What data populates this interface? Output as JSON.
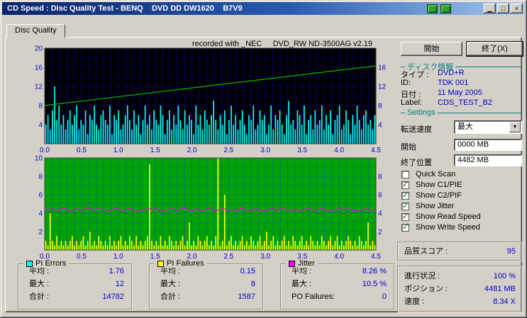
{
  "window": {
    "title": "CD Speed : Disc Quality Test - BENQ    DVD DD DW1620    B7V9"
  },
  "tabs": {
    "disc_quality": "Disc Quality"
  },
  "chart_header": "recorded with _NEC     DVD_RW ND-3500AG v2.19",
  "sidebar": {
    "start_button": "開始",
    "exit_button": "終了(X)",
    "disc_info": {
      "header": "ディスク情報",
      "rows": [
        [
          "タイプ :",
          "DVD+R"
        ],
        [
          "ID:",
          "TDK 001"
        ],
        [
          "日付 :",
          "11 May 2005"
        ],
        [
          "Label:",
          "CDS_TEST_B2"
        ]
      ]
    },
    "settings": {
      "header": "Settings",
      "speed_label": "転送速度",
      "speed_value": "最大",
      "start_label": "開始",
      "start_value": "0000 MB",
      "end_label": "終了位置",
      "end_value": "4482 MB",
      "checkboxes": [
        {
          "label": "Quick Scan",
          "checked": false
        },
        {
          "label": "Show C1/PIE",
          "checked": true
        },
        {
          "label": "Show C2/PIF",
          "checked": true
        },
        {
          "label": "Show Jitter",
          "checked": true
        },
        {
          "label": "Show Read Speed",
          "checked": true
        },
        {
          "label": "Show Write Speed",
          "checked": true
        }
      ]
    },
    "quality": {
      "label": "品質スコア :",
      "value": "95"
    },
    "status": {
      "rows": [
        [
          "進行状況 :",
          "100 %"
        ],
        [
          "ポジション :",
          "4481 MB"
        ],
        [
          "速度 :",
          "8.34 X"
        ]
      ]
    }
  },
  "stats_boxes": [
    {
      "title": "PI Errors",
      "color": "#00FFFF",
      "rows": [
        [
          "平均 :",
          "1.76"
        ],
        [
          "最大 :",
          "12"
        ],
        [
          "合計 :",
          "14782"
        ]
      ]
    },
    {
      "title": "PI Failures",
      "color": "#FFFF00",
      "rows": [
        [
          "平均 :",
          "0.15"
        ],
        [
          "最大 :",
          "8"
        ],
        [
          "合計 :",
          "1587"
        ]
      ]
    },
    {
      "title": "Jitter",
      "color": "#FF00FF",
      "rows": [
        [
          "平均 :",
          "8.26 %"
        ],
        [
          "最大 :",
          "10.5 %"
        ],
        [
          "PO Failures:",
          "0"
        ]
      ]
    }
  ],
  "chart_data": [
    {
      "type": "bar",
      "title": "PI Errors vs disc position (GB) with write speed line",
      "x_range": [
        0,
        4.5
      ],
      "y_range": [
        0,
        20
      ],
      "grid_x": 0.1,
      "grid_y": 2,
      "x_ticks": [
        "0.0",
        "0.5",
        "1.0",
        "1.5",
        "2.0",
        "2.5",
        "3.0",
        "3.5",
        "4.0",
        "4.5"
      ],
      "y_ticks_left": [
        20,
        16,
        12,
        8,
        4
      ],
      "y_ticks_right": [
        16,
        12,
        8,
        4
      ],
      "bg": "#000000",
      "grid_color": "#0000A8",
      "tick_color": "#0000C8",
      "bar_color": "#00FFFF",
      "bars": [
        4,
        6,
        3,
        7,
        12,
        5,
        8,
        4,
        6,
        3,
        5,
        7,
        4,
        6,
        8,
        3,
        5,
        4,
        7,
        2,
        6,
        5,
        8,
        4,
        3,
        6,
        7,
        5,
        4,
        8,
        2,
        6,
        5,
        7,
        3,
        4,
        6,
        8,
        5,
        3,
        7,
        4,
        6,
        2,
        5,
        8,
        4,
        6,
        3,
        7,
        5,
        4,
        8,
        6,
        2,
        5,
        7,
        3,
        6,
        4,
        8,
        5,
        3,
        7,
        4,
        6,
        5,
        2,
        8,
        4,
        6,
        3,
        7,
        5,
        4,
        6,
        9,
        5,
        3,
        6,
        4,
        7,
        2,
        5,
        8,
        4,
        6,
        3,
        5,
        7,
        4,
        2,
        6,
        5,
        8,
        3,
        4,
        7,
        5,
        6,
        2,
        4,
        8,
        3,
        6,
        5,
        7,
        4,
        2,
        6,
        9,
        4,
        5,
        3,
        7,
        6,
        4,
        8,
        2,
        5,
        6,
        3,
        7,
        4,
        5,
        8,
        3,
        6,
        4,
        7,
        2,
        5,
        6,
        8,
        3,
        4,
        7,
        5,
        2,
        6,
        4,
        8,
        5,
        3,
        6,
        7,
        4,
        5,
        3,
        6
      ],
      "lines": [
        {
          "name": "write-speed",
          "color": "#00C000",
          "points": [
            [
              0,
              8
            ],
            [
              4.5,
              16.3
            ]
          ]
        }
      ]
    },
    {
      "type": "bar",
      "title": "PI Failures vs disc position (GB) with jitter line",
      "x_range": [
        0,
        4.5
      ],
      "y_range": [
        0,
        10
      ],
      "grid_x": 0.1,
      "grid_y": 1,
      "x_ticks": [
        "0.0",
        "0.5",
        "1.0",
        "1.5",
        "2.0",
        "2.5",
        "3.0",
        "3.5",
        "4.0",
        "4.5"
      ],
      "y_ticks_left": [
        10,
        8,
        6,
        4,
        2
      ],
      "y_ticks_right": [
        8,
        6,
        4,
        2
      ],
      "bg": "#00A400",
      "grid_color": "#0058A8",
      "tick_color": "#0000C8",
      "bar_color": "#FFFF00",
      "bars": [
        1,
        0.5,
        4,
        1,
        0.5,
        1.5,
        0.5,
        1,
        0.5,
        1,
        0.5,
        1,
        1.5,
        0.5,
        1,
        0.5,
        1,
        1.5,
        0.5,
        1,
        2,
        0.5,
        1,
        0.5,
        1.5,
        1,
        0.5,
        1,
        0.5,
        1.5,
        0.5,
        1,
        0.5,
        1,
        1.5,
        0.5,
        1,
        0.5,
        1.5,
        1,
        0.5,
        1.5,
        0.5,
        1,
        0.5,
        1,
        1.5,
        9.3,
        1,
        0.5,
        1,
        0.5,
        1.5,
        0.5,
        1,
        0.5,
        1.5,
        1,
        0.5,
        1,
        0.5,
        1,
        1.5,
        0.5,
        1,
        3,
        0.5,
        1,
        0.5,
        1.5,
        1,
        0.5,
        1,
        1.5,
        0.5,
        1,
        0.5,
        1.5,
        10,
        0.5,
        1,
        6,
        0.5,
        1,
        1.5,
        0.5,
        1,
        0.5,
        1,
        1.5,
        0.5,
        1,
        0.5,
        1.5,
        1,
        0.5,
        1,
        1.5,
        0.5,
        1,
        2,
        0.5,
        1,
        1.5,
        0.5,
        1,
        0.5,
        1,
        1.5,
        0.5,
        1,
        0.5,
        1.5,
        1,
        0.5,
        1,
        1.5,
        0.5,
        1,
        0.5,
        1.5,
        1,
        0.5,
        1,
        0.5,
        1.5,
        1,
        0.5,
        1,
        1.5,
        0.5,
        1,
        1.5,
        0.5,
        1,
        0.5,
        1,
        1.5,
        1,
        0.5,
        1,
        0.5,
        1.5,
        1,
        0.5,
        1,
        3,
        0.5,
        1,
        0.5
      ],
      "lines": [
        {
          "name": "jitter",
          "color": "#FF00FF",
          "values": [
            4.6,
            4.4,
            4.5,
            4.3,
            4.6,
            4.4,
            4.2,
            4.5,
            4.3,
            4.4,
            4.6,
            4.3,
            4.5,
            4.4,
            4.2,
            4.4,
            4.6,
            4.3,
            4.4,
            4.5,
            4.2,
            4.4,
            4.3,
            4.6,
            4.4,
            4.5,
            4.2,
            4.3,
            4.5,
            4.4,
            4.3,
            4.6,
            4.4,
            4.2,
            4.5,
            4.3,
            4.4,
            4.6,
            4.2,
            4.4,
            4.5,
            4.3,
            4.4,
            4.2,
            4.6,
            4.4,
            4.3,
            4.5,
            4.4,
            4.2,
            4.4,
            4.5,
            4.3,
            4.6,
            4.4,
            4.2,
            4.5,
            4.3,
            4.4,
            4.6,
            4.3,
            4.4,
            4.5,
            4.2,
            4.4,
            4.3,
            4.6,
            4.4,
            4.5,
            4.3,
            4.2,
            4.4,
            4.5,
            4.3,
            4.4
          ]
        }
      ]
    }
  ]
}
